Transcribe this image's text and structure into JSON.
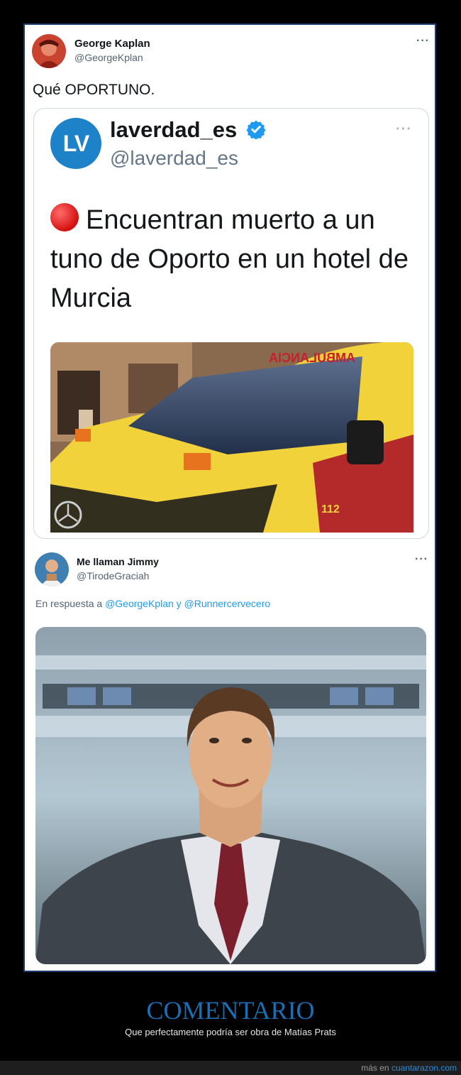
{
  "tweet": {
    "author_name": "George Kaplan",
    "author_handle": "@GeorgeKplan",
    "text": "Qué OPORTUNO.",
    "more_icon": "more-icon"
  },
  "quoted": {
    "logo_text": "LV",
    "author_name": "laverdad_es",
    "author_handle": "@laverdad_es",
    "verified_icon": "verified-icon",
    "headline_icon": "red-circle-icon",
    "headline": "Encuentran muerto a un tuno de Oporto en un hotel de Murcia",
    "image_icon": "ambulance-photo",
    "ambulance_sign": "AMBULANCIA",
    "ambulance_number": "112"
  },
  "reply": {
    "author_name": "Me llaman Jimmy",
    "author_handle": "@TirodeGraciah",
    "reply_prefix": "En respuesta a",
    "mention_1": "@GeorgeKplan",
    "conjunction": "y",
    "mention_2": "@Runnercervecero",
    "image_icon": "news-anchor-photo"
  },
  "comment": {
    "title": "COMENTARIO",
    "text": "Que perfectamente podría ser obra de Matías Prats"
  },
  "footer": {
    "prefix": "más en",
    "site": "cuantarazon.com"
  },
  "colors": {
    "accent_blue": "#1d9bf0",
    "comment_title": "#1a6fb4",
    "frame_border": "#1d3b6e",
    "ambulance_yellow": "#f2d23a"
  }
}
